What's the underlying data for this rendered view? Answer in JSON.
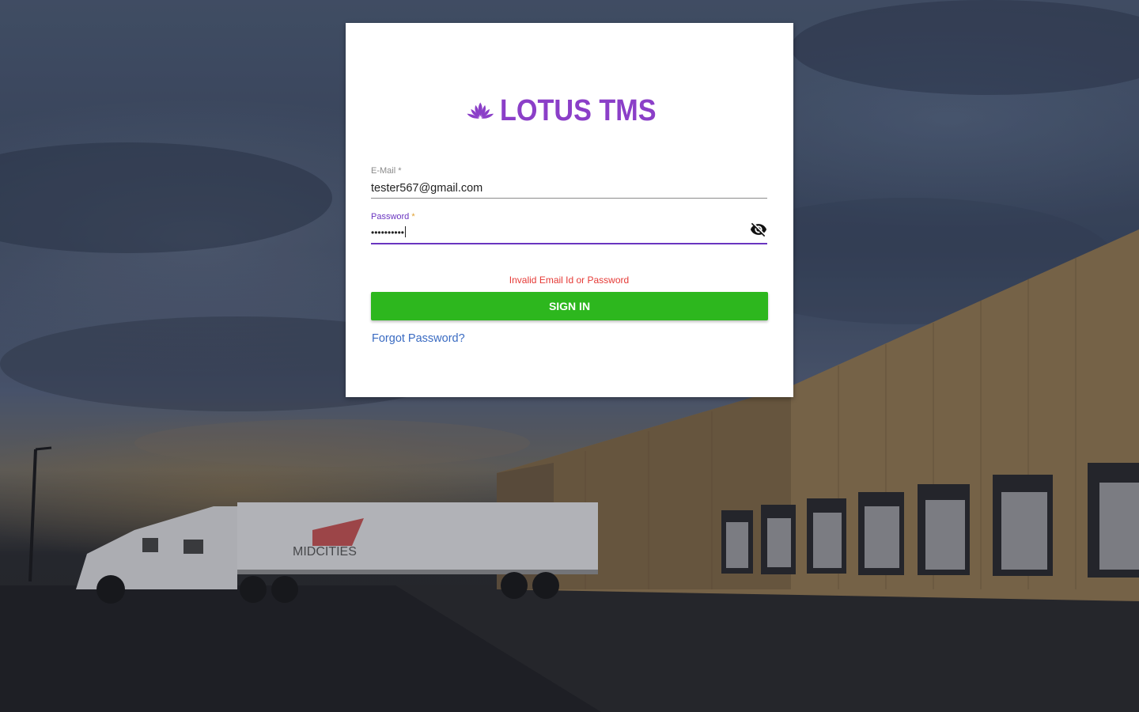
{
  "brand": {
    "logo_text": "LOTUS TMS",
    "color": "#8b3fc8"
  },
  "form": {
    "email": {
      "label": "E-Mail",
      "required_mark": "*",
      "value": "tester567@gmail.com"
    },
    "password": {
      "label": "Password",
      "required_mark": "*",
      "masked_value": "••••••••••",
      "toggle_icon": "visibility-off-icon"
    },
    "error_message": "Invalid Email Id or Password",
    "submit_label": "SIGN IN",
    "forgot_label": "Forgot Password?"
  },
  "background": {
    "trailer_logo_text": "MIDCITIES"
  },
  "colors": {
    "primary": "#6a35c0",
    "button": "#2db71e",
    "error": "#e53935",
    "link": "#3a6bc2"
  }
}
